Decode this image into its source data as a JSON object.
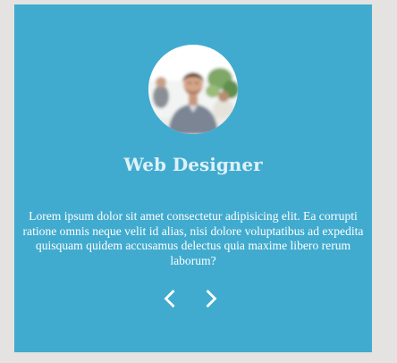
{
  "testimonial": {
    "title": "Web Designer",
    "description": "Lorem ipsum dolor sit amet consectetur adipisicing elit. Ea corrupti ratione omnis neque velit id alias, nisi dolore voluptatibus ad expedita quisquam quidem accusamus delectus quia maxime libero rerum laborum?",
    "avatar_icon": "person-photo-icon"
  },
  "navigation": {
    "prev_icon": "chevron-left-icon",
    "next_icon": "chevron-right-icon"
  },
  "colors": {
    "card_background": "#41abcf",
    "page_background": "#e4e3e1",
    "title": "#dff1f8",
    "text": "#ffffff"
  }
}
